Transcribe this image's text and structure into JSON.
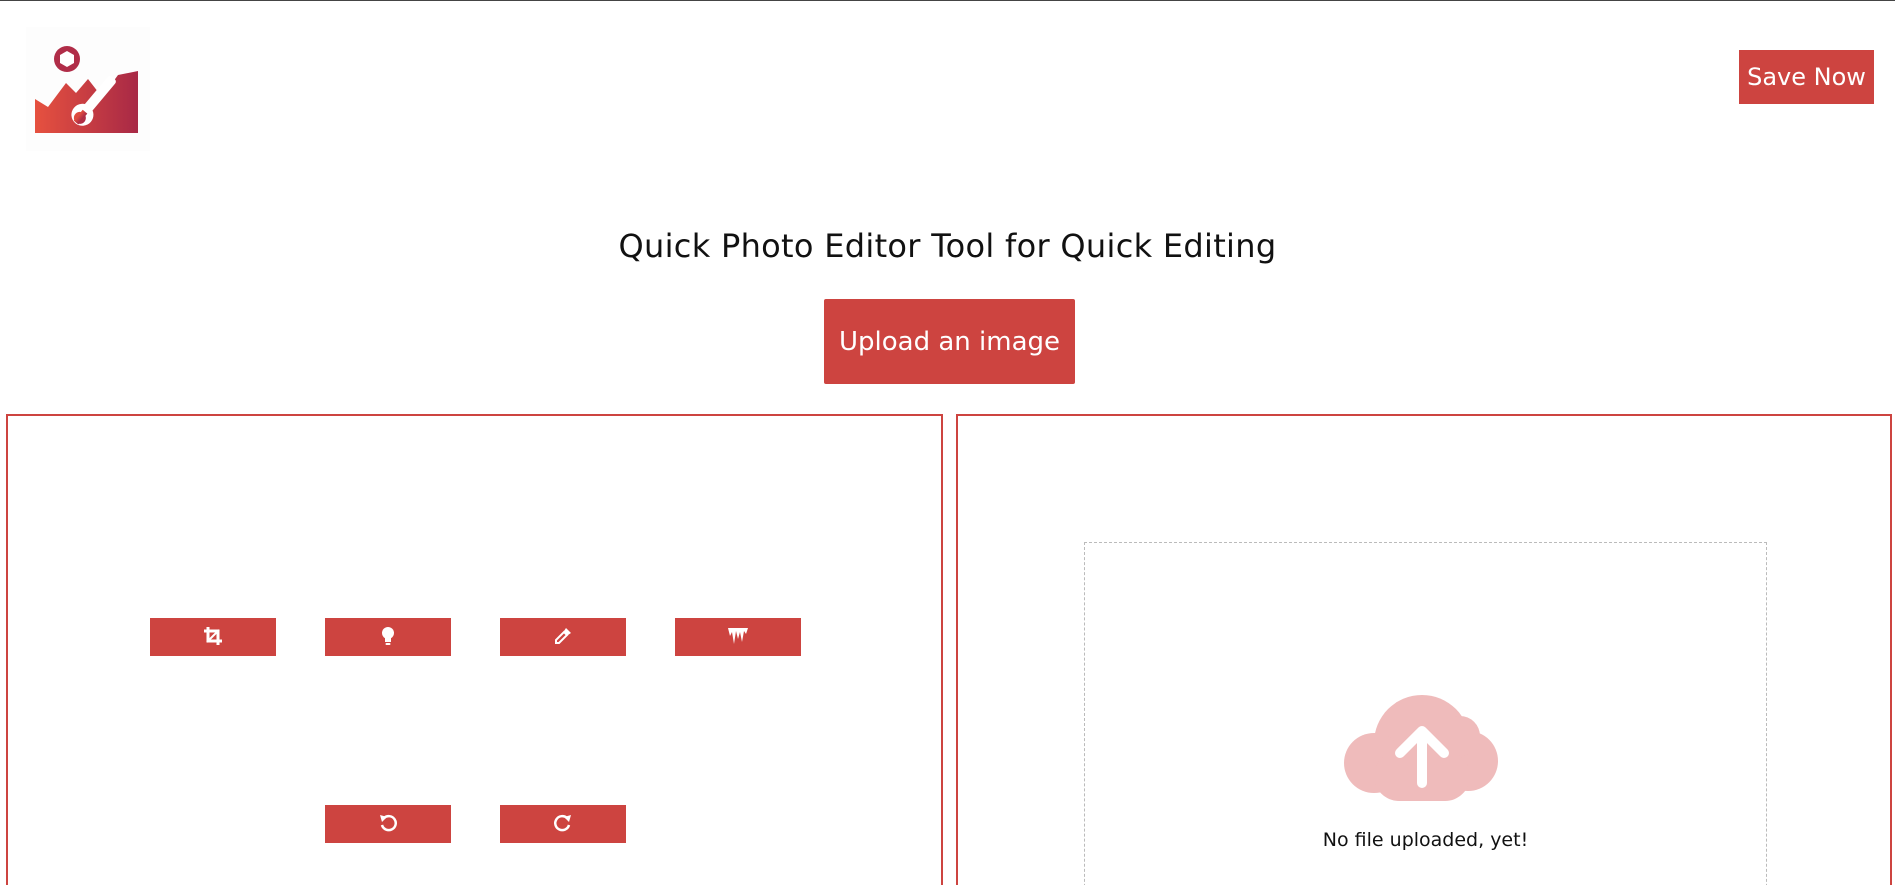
{
  "header": {
    "logo_name": "photo-editor-logo",
    "save_label": "Save Now"
  },
  "main": {
    "title": "Quick Photo Editor Tool for Quick Editing",
    "upload_label": "Upload an image"
  },
  "tools": {
    "row1": [
      "crop-icon",
      "lightbulb-icon",
      "eyedropper-icon",
      "icicles-icon"
    ],
    "row2": [
      "undo-icon",
      "redo-icon"
    ]
  },
  "preview": {
    "empty_text": "No file uploaded, yet!",
    "icon": "cloud-upload-icon"
  },
  "colors": {
    "accent": "#cd4440",
    "cloud": "#efbbbb"
  }
}
